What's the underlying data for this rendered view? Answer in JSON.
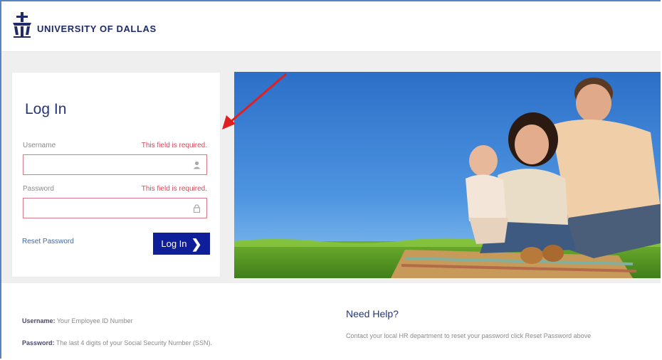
{
  "header": {
    "org_name": "UNIVERSITY OF DALLAS",
    "logo_icon": "university-crest-icon"
  },
  "login": {
    "title": "Log In",
    "username_label": "Username",
    "username_error": "This field is required.",
    "username_value": "",
    "password_label": "Password",
    "password_error": "This field is required.",
    "password_value": "",
    "reset_link": "Reset Password",
    "submit_label": "Log In",
    "submit_icon": "chevron-right-icon",
    "colors": {
      "button": "#0f1f99",
      "error": "#d8465a",
      "title": "#24357c"
    }
  },
  "hero": {
    "alt_icon": "family-photo"
  },
  "footer": {
    "username_key": "Username:",
    "username_value": "Your Employee ID Number",
    "password_key": "Password:",
    "password_value": "The last 4 digits of your Social Security Number (SSN).",
    "help_title": "Need Help?",
    "help_text": "Contact your local HR department to reset your password click Reset Password above"
  }
}
